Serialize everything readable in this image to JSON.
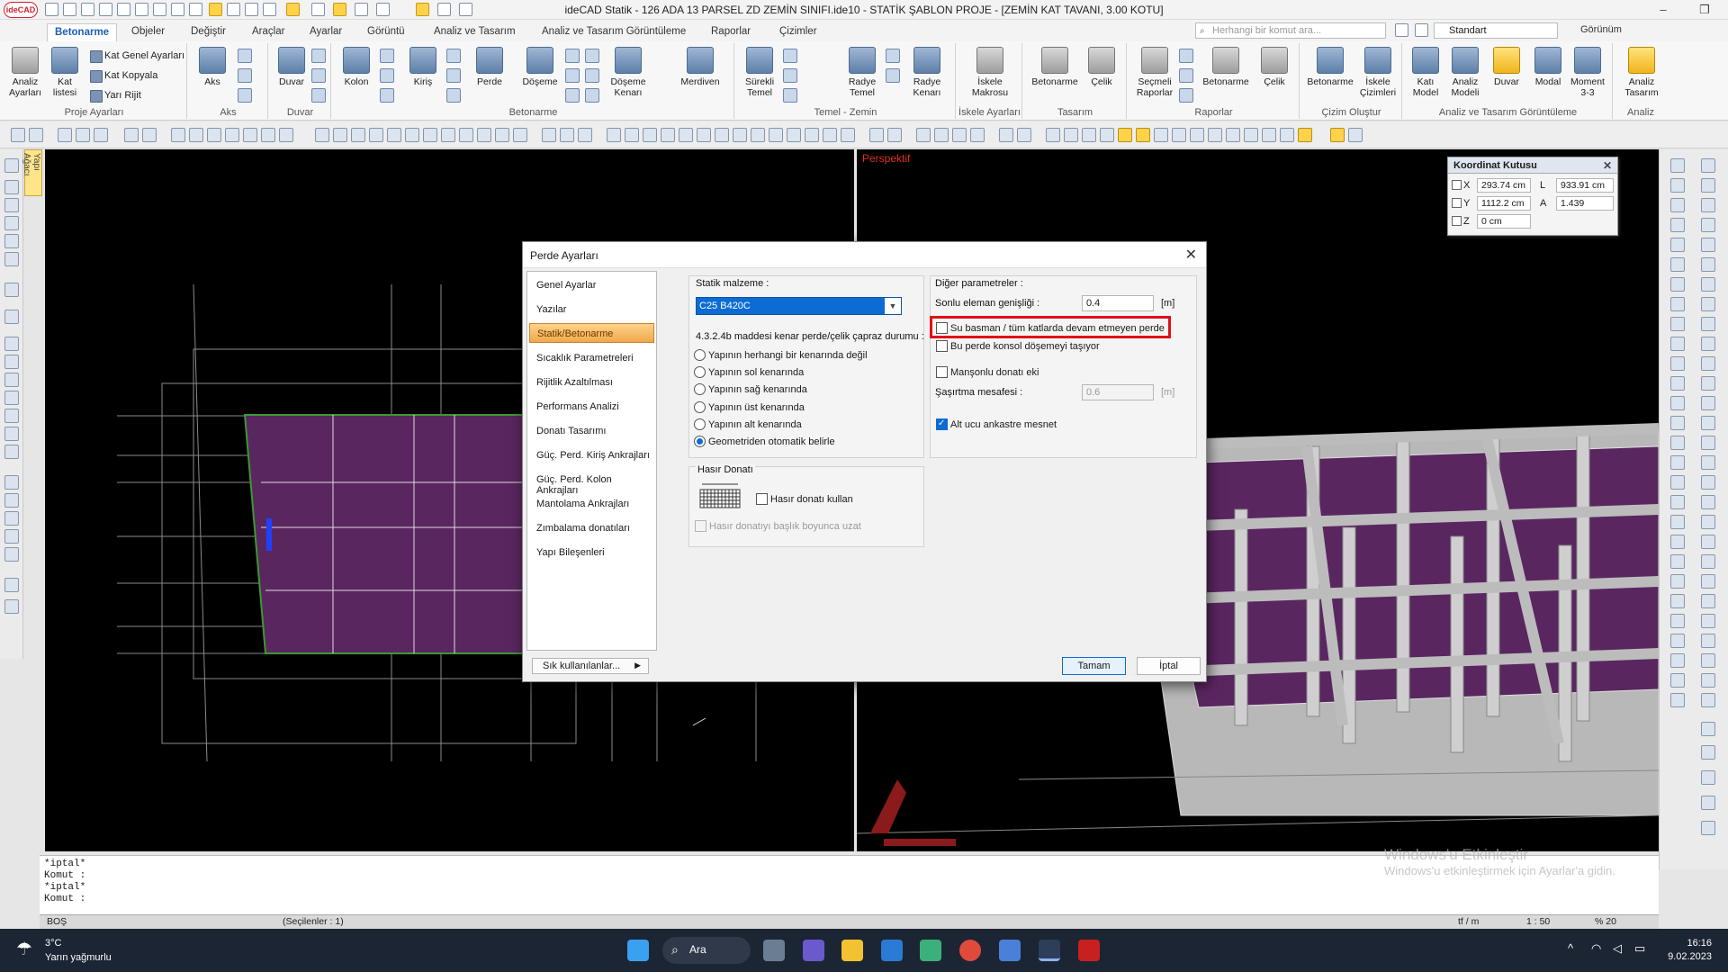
{
  "app": {
    "title": "ideCAD Statik - 126 ADA 13 PARSEL ZD ZEMİN SINIFI.ide10 - STATİK ŞABLON PROJE - [ZEMİN KAT TAVANI,  3.00 KOTU]",
    "logo": "ideCAD"
  },
  "tabs": [
    "Betonarme",
    "Objeler",
    "Değiştir",
    "Araçlar",
    "Ayarlar",
    "Görüntü",
    "Analiz ve Tasarım",
    "Analiz ve Tasarım Görüntüleme",
    "Raporlar",
    "Çizimler"
  ],
  "search_placeholder": "Herhangi bir komut ara...",
  "style_combo": "Standart",
  "view_menu": "Görünüm",
  "ribbon": {
    "groups": [
      {
        "label": "Proje Ayarları",
        "buttons": [
          "Analiz Ayarları",
          "Kat listesi"
        ],
        "small": [
          "Kat Genel Ayarları",
          "Kat Kopyala",
          "Yarı Rijit"
        ]
      },
      {
        "label": "Aks",
        "buttons": [
          "Aks"
        ]
      },
      {
        "label": "Duvar",
        "buttons": [
          "Duvar"
        ]
      },
      {
        "label": "Betonarme",
        "buttons": [
          "Kolon",
          "Kiriş",
          "Perde",
          "Döşeme",
          "Döşeme Kenarı",
          "Merdiven"
        ]
      },
      {
        "label": "Temel - Zemin",
        "buttons": [
          "Sürekli Temel",
          "Radye Temel",
          "Radye Kenarı"
        ]
      },
      {
        "label": "İskele Ayarları",
        "buttons": [
          "İskele Makrosu"
        ]
      },
      {
        "label": "Tasarım",
        "buttons": [
          "Betonarme",
          "Çelik"
        ]
      },
      {
        "label": "Raporlar",
        "buttons": [
          "Seçmeli Raporlar",
          "Betonarme",
          "Çelik"
        ]
      },
      {
        "label": "Çizim Oluştur",
        "buttons": [
          "Betonarme",
          "İskele Çizimleri"
        ]
      },
      {
        "label": "Analiz ve Tasarım Görüntüleme",
        "buttons": [
          "Katı Model",
          "Analiz Modeli",
          "Duvar",
          "Modal",
          "Moment 3-3"
        ]
      },
      {
        "label": "Analiz",
        "buttons": [
          "Analiz Tasarım"
        ]
      }
    ]
  },
  "left_panel_tab": "Yapı Ağacı",
  "viewport_right_label": "Perspektif",
  "coord_box": {
    "title": "Koordinat Kutusu",
    "x_label": "X",
    "x_value": "293.74 cm",
    "y_label": "Y",
    "y_value": "1112.2 cm",
    "z_label": "Z",
    "z_value": "0 cm",
    "l_label": "L",
    "l_value": "933.91 cm",
    "a_label": "A",
    "a_value": "1.439"
  },
  "dialog": {
    "title": "Perde Ayarları",
    "nav": [
      "Genel Ayarlar",
      "Yazılar",
      "Statik/Betonarme",
      "Sıcaklık Parametreleri",
      "Rijitlik Azaltılması",
      "Performans Analizi",
      "Donatı Tasarımı",
      "Güç. Perd. Kiriş Ankrajları",
      "Güç. Perd. Kolon Ankrajları",
      "Mantolama Ankrajları",
      "Zımbalama donatıları",
      "Yapı Bileşenleri"
    ],
    "selected_nav": "Statik/Betonarme",
    "static_material_label": "Statik malzeme :",
    "static_material_value": "C25 B420C",
    "edge_section_label": "4.3.2.4b maddesi kenar perde/çelik çapraz durumu :",
    "edge_options": [
      "Yapının herhangi bir kenarında değil",
      "Yapının sol kenarında",
      "Yapının sağ kenarında",
      "Yapının üst kenarında",
      "Yapının alt kenarında",
      "Geometriden otomatik belirle"
    ],
    "edge_selected": "Geometriden otomatik belirle",
    "mesh_section_label": "Hasır Donatı",
    "mesh_use_label": "Hasır donatı kullan",
    "mesh_extend_label": "Hasır donatıyı başlık boyunca uzat",
    "other_params_label": "Diğer parametreler :",
    "finite_width_label": "Sonlu eleman genişliği :",
    "finite_width_value": "0.4",
    "unit_m": "[m]",
    "su_basman_label": "Su basman / tüm katlarda devam etmeyen perde",
    "konsol_label": "Bu perde konsol döşemeyi taşıyor",
    "mansonlu_label": "Manşonlu donatı eki",
    "sasirtma_label": "Şaşırtma mesafesi :",
    "sasirtma_value": "0.6",
    "alt_ucu_label": "Alt ucu ankastre mesnet",
    "favorites_button": "Sık kullanılanlar...",
    "ok_button": "Tamam",
    "cancel_button": "İptal"
  },
  "command_history": [
    "*iptal*",
    "Komut :",
    "*iptal*",
    "Komut :"
  ],
  "status": {
    "state": "BOŞ",
    "selected": "(Seçilenler : 1)",
    "unit": "tf / m",
    "scale": "1 : 50",
    "zoom": "% 20"
  },
  "watermark": {
    "line1": "Windows'u Etkinleştir",
    "line2": "Windows'u etkinleştirmek için Ayarlar'a gidin."
  },
  "taskbar": {
    "temp": "3°C",
    "weather": "Yarın yağmurlu",
    "search": "Ara",
    "time": "16:16",
    "date": "9.02.2023"
  },
  "colors": {
    "accent": "#0c6cd4",
    "highlight": "#e01018",
    "selected_nav": "#f0a84c",
    "slab": "#6a2a6a"
  }
}
